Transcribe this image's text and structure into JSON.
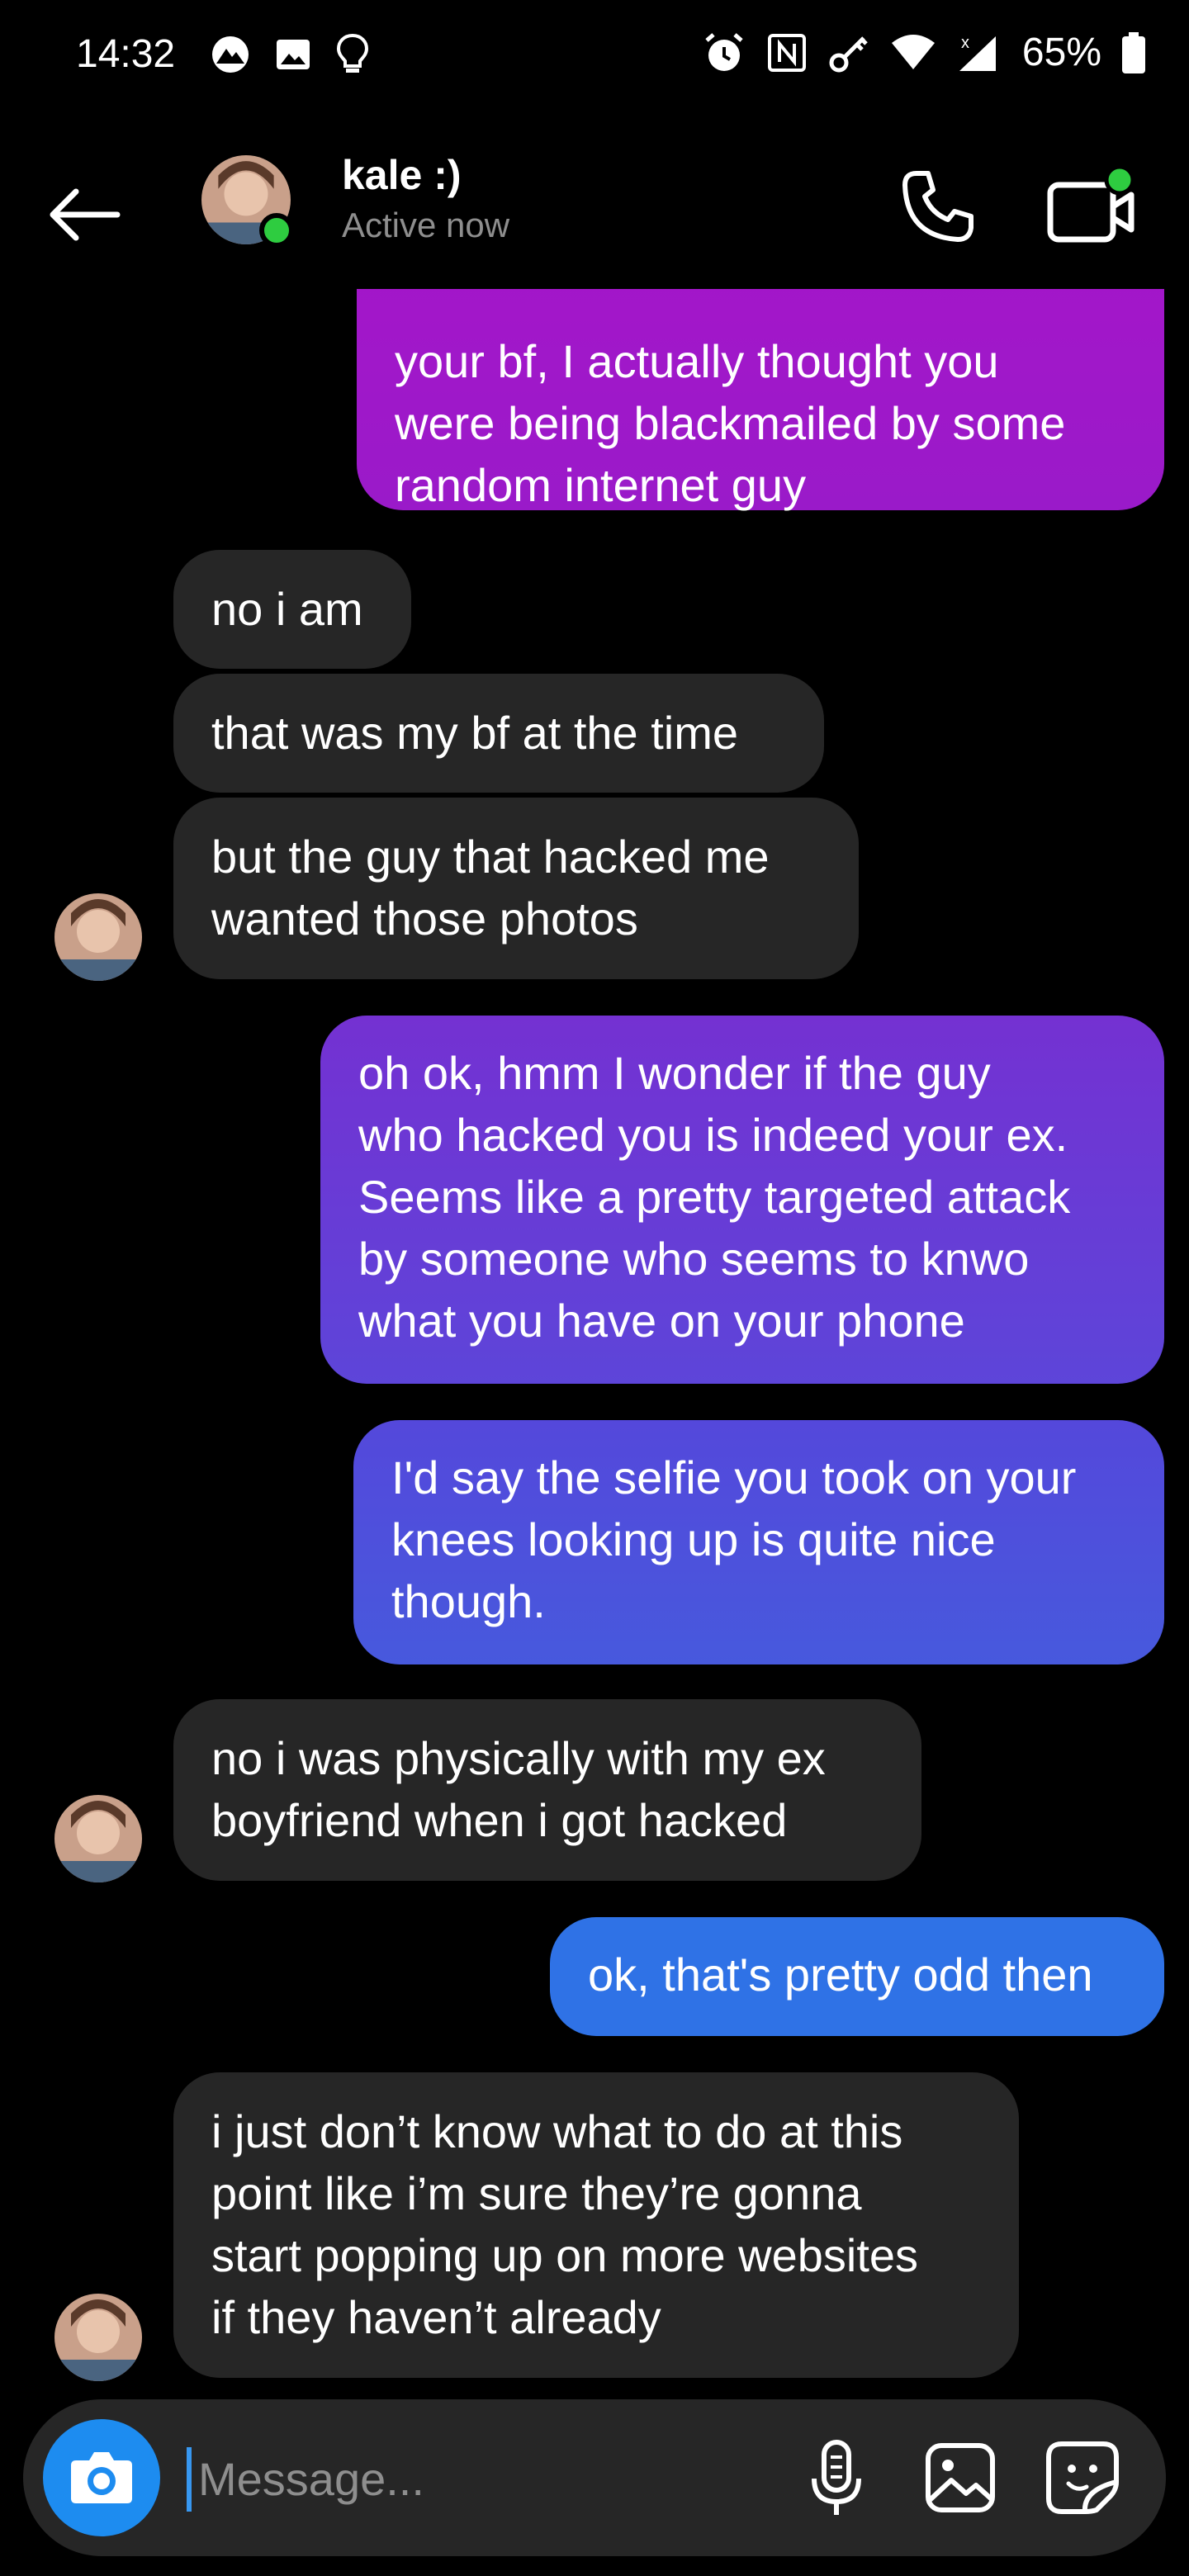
{
  "status_bar": {
    "time": "14:32",
    "battery": "65%"
  },
  "header": {
    "contact_name": "kale :)",
    "status": "Active now"
  },
  "messages": [
    {
      "from": "me",
      "text": "your bf, I actually thought you\nwere being blackmailed by some\nrandom internet guy"
    },
    {
      "from": "them",
      "text": "no i am"
    },
    {
      "from": "them",
      "text": "that was my bf at the time"
    },
    {
      "from": "them",
      "text": "but the guy that hacked me\nwanted those photos"
    },
    {
      "from": "me",
      "text": "oh ok, hmm I wonder if the guy\nwho hacked you is indeed your ex.\nSeems like a pretty targeted attack\nby someone who seems to knwo\nwhat you have on your phone"
    },
    {
      "from": "me",
      "text": "I'd say the selfie you took on your\nknees looking up is quite nice\nthough."
    },
    {
      "from": "them",
      "text": "no i was physically with my ex\nboyfriend when i got hacked"
    },
    {
      "from": "me",
      "text": "ok, that's pretty odd then"
    },
    {
      "from": "them",
      "text": "i just don’t know what to do at this\npoint like i’m sure they’re gonna\nstart popping up on more websites\nif they haven’t already"
    }
  ],
  "composer": {
    "placeholder": "Message..."
  },
  "colors": {
    "bubble_in": "#262626",
    "gradient_top": "#a416c9",
    "gradient_mid": "#6a3fd8",
    "gradient_bottom": "#2f72e6",
    "online": "#2ecc40",
    "camera": "#1d8cf0"
  },
  "icons": [
    "back-arrow-icon",
    "phone-icon",
    "video-camera-icon",
    "camera-icon",
    "microphone-icon",
    "gallery-icon",
    "sticker-icon"
  ]
}
